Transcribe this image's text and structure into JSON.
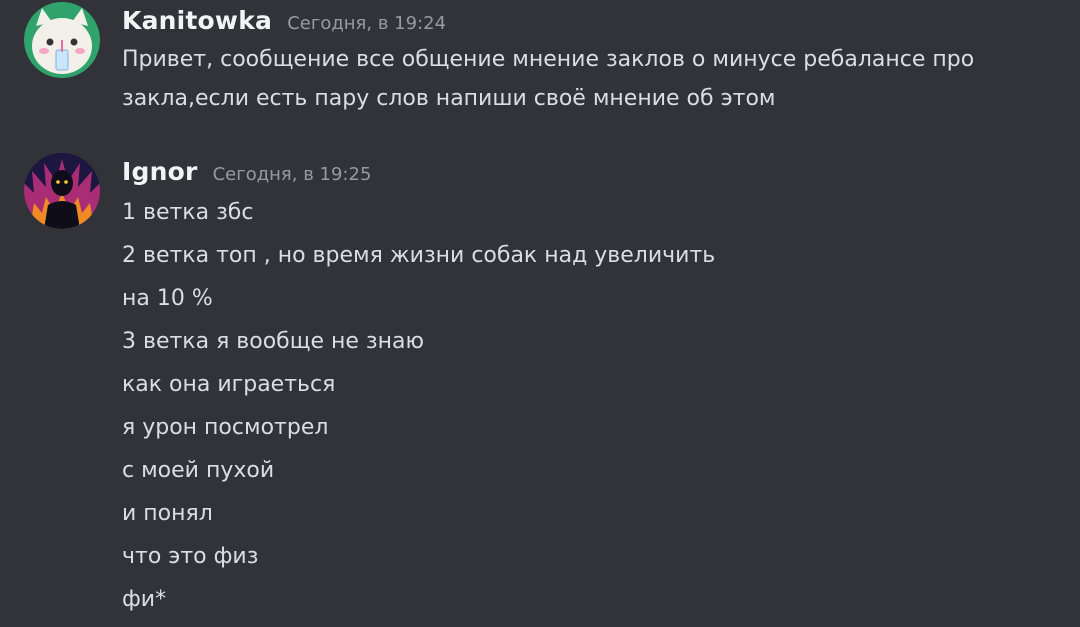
{
  "messages": [
    {
      "author": "Kanitowka",
      "timestamp": "Сегодня, в 19:24",
      "avatar_icon": "cat-avatar-icon",
      "lines": [
        "Привет, сообщение все общение мнение заклов о минусе ребалансе про",
        "закла,если есть пару слов напиши своё мнение об этом"
      ]
    },
    {
      "author": "Ignor",
      "timestamp": "Сегодня, в 19:25",
      "avatar_icon": "dark-figure-avatar-icon",
      "lines": [
        "1 ветка збс",
        "2 ветка топ , но время жизни собак над увеличить",
        "на 10 %",
        "3 ветка я вообще не знаю",
        "как она играеться",
        "я урон посмотрел",
        "с моей пухой",
        "и понял",
        "что это физ",
        "фи*"
      ]
    }
  ],
  "colors": {
    "background": "#313338",
    "username": "#f2f3f5",
    "timestamp": "#949ba4",
    "text": "#dbdee1"
  }
}
